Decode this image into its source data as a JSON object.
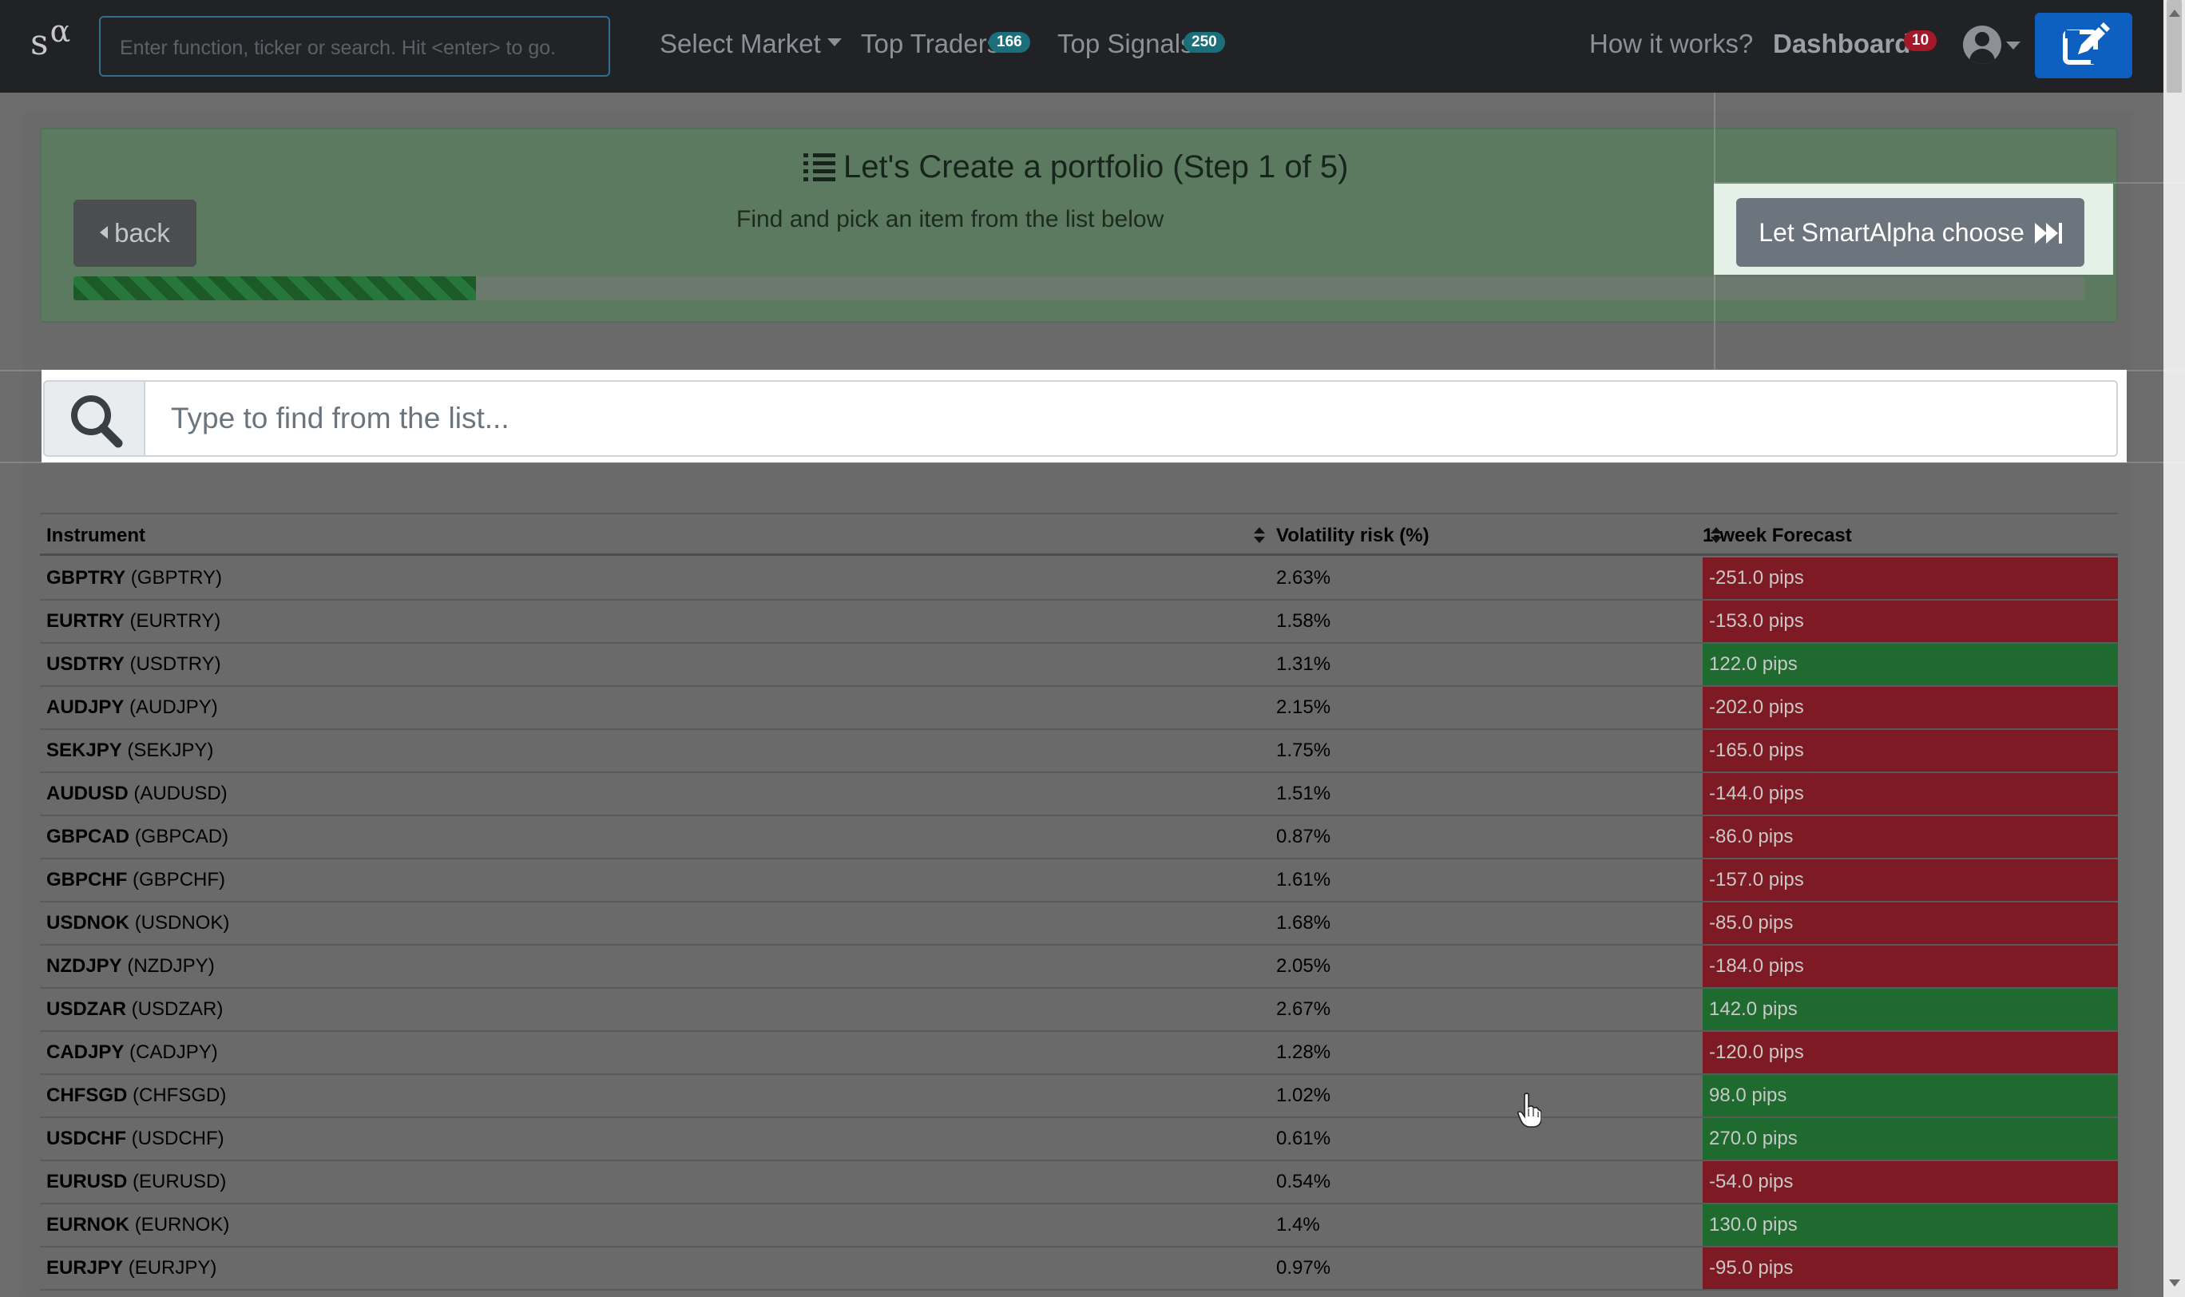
{
  "navbar": {
    "logo_s": "s",
    "logo_alpha": "α",
    "search_placeholder": "Enter function, ticker or search. Hit <enter> to go.",
    "select_market": "Select Market",
    "top_traders": "Top Traders",
    "top_traders_count": "166",
    "top_signals": "Top Signals",
    "top_signals_count": "250",
    "how_it_works": "How it works?",
    "dashboard": "Dashboard",
    "dashboard_count": "10"
  },
  "step": {
    "title": "Let's Create a portfolio (Step 1 of 5)",
    "subtitle": "Find and pick an item from the list below",
    "back_label": "back",
    "choose_label": "Let SmartAlpha choose",
    "progress": 0.2
  },
  "search": {
    "placeholder": "Type to find from the list..."
  },
  "table": {
    "headers": [
      "Instrument",
      "Volatility risk (%)",
      "1-week Forecast"
    ],
    "rows": [
      {
        "symbol": "GBPTRY",
        "paren": "(GBPTRY)",
        "vol": "2.63%",
        "forecast": "-251.0 pips",
        "dir": "neg"
      },
      {
        "symbol": "EURTRY",
        "paren": "(EURTRY)",
        "vol": "1.58%",
        "forecast": "-153.0 pips",
        "dir": "neg"
      },
      {
        "symbol": "USDTRY",
        "paren": "(USDTRY)",
        "vol": "1.31%",
        "forecast": "122.0 pips",
        "dir": "pos"
      },
      {
        "symbol": "AUDJPY",
        "paren": "(AUDJPY)",
        "vol": "2.15%",
        "forecast": "-202.0 pips",
        "dir": "neg"
      },
      {
        "symbol": "SEKJPY",
        "paren": "(SEKJPY)",
        "vol": "1.75%",
        "forecast": "-165.0 pips",
        "dir": "neg"
      },
      {
        "symbol": "AUDUSD",
        "paren": "(AUDUSD)",
        "vol": "1.51%",
        "forecast": "-144.0 pips",
        "dir": "neg"
      },
      {
        "symbol": "GBPCAD",
        "paren": "(GBPCAD)",
        "vol": "0.87%",
        "forecast": "-86.0 pips",
        "dir": "neg"
      },
      {
        "symbol": "GBPCHF",
        "paren": "(GBPCHF)",
        "vol": "1.61%",
        "forecast": "-157.0 pips",
        "dir": "neg"
      },
      {
        "symbol": "USDNOK",
        "paren": "(USDNOK)",
        "vol": "1.68%",
        "forecast": "-85.0 pips",
        "dir": "neg"
      },
      {
        "symbol": "NZDJPY",
        "paren": "(NZDJPY)",
        "vol": "2.05%",
        "forecast": "-184.0 pips",
        "dir": "neg"
      },
      {
        "symbol": "USDZAR",
        "paren": "(USDZAR)",
        "vol": "2.67%",
        "forecast": "142.0 pips",
        "dir": "pos"
      },
      {
        "symbol": "CADJPY",
        "paren": "(CADJPY)",
        "vol": "1.28%",
        "forecast": "-120.0 pips",
        "dir": "neg"
      },
      {
        "symbol": "CHFSGD",
        "paren": "(CHFSGD)",
        "vol": "1.02%",
        "forecast": "98.0 pips",
        "dir": "pos"
      },
      {
        "symbol": "USDCHF",
        "paren": "(USDCHF)",
        "vol": "0.61%",
        "forecast": "270.0 pips",
        "dir": "pos"
      },
      {
        "symbol": "EURUSD",
        "paren": "(EURUSD)",
        "vol": "0.54%",
        "forecast": "-54.0 pips",
        "dir": "neg"
      },
      {
        "symbol": "EURNOK",
        "paren": "(EURNOK)",
        "vol": "1.4%",
        "forecast": "130.0 pips",
        "dir": "pos"
      },
      {
        "symbol": "EURJPY",
        "paren": "(EURJPY)",
        "vol": "0.97%",
        "forecast": "-95.0 pips",
        "dir": "neg"
      }
    ]
  },
  "colors": {
    "negative": "#7e1a24",
    "positive": "#1f6a2e",
    "accent": "#0d5fc0"
  }
}
